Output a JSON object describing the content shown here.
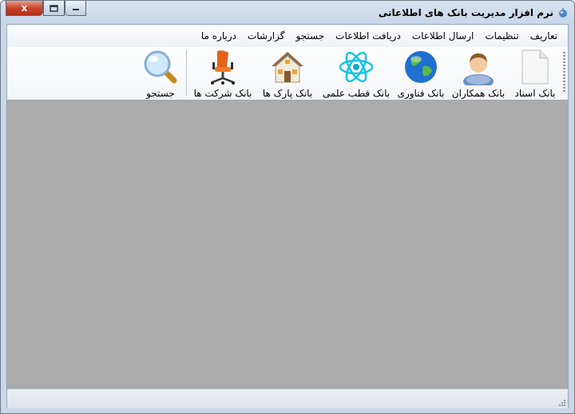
{
  "window": {
    "title": "نرم افزار مدیریت بانک های اطلاعاتی",
    "close_label": "x"
  },
  "menu": {
    "items": [
      "تعاریف",
      "تنظیمات",
      "ارسال اطلاعات",
      "دریافت اطلاعات",
      "جستجو",
      "گزارشات",
      "درباره ما"
    ]
  },
  "toolbar": {
    "documents_bank": "بانک اسناد",
    "colleagues_bank": "بانک همکاران",
    "technology_bank": "بانک فناوری",
    "science_hub_bank": "بانک قطب علمی",
    "parks_bank": "بانک پارک ها",
    "companies_bank": "بانک شرکت ها",
    "search": "جستجو"
  },
  "colors": {
    "mdi_background": "#ababab",
    "title_gradient": "#d9e4f1",
    "close_button": "#c7432b"
  }
}
